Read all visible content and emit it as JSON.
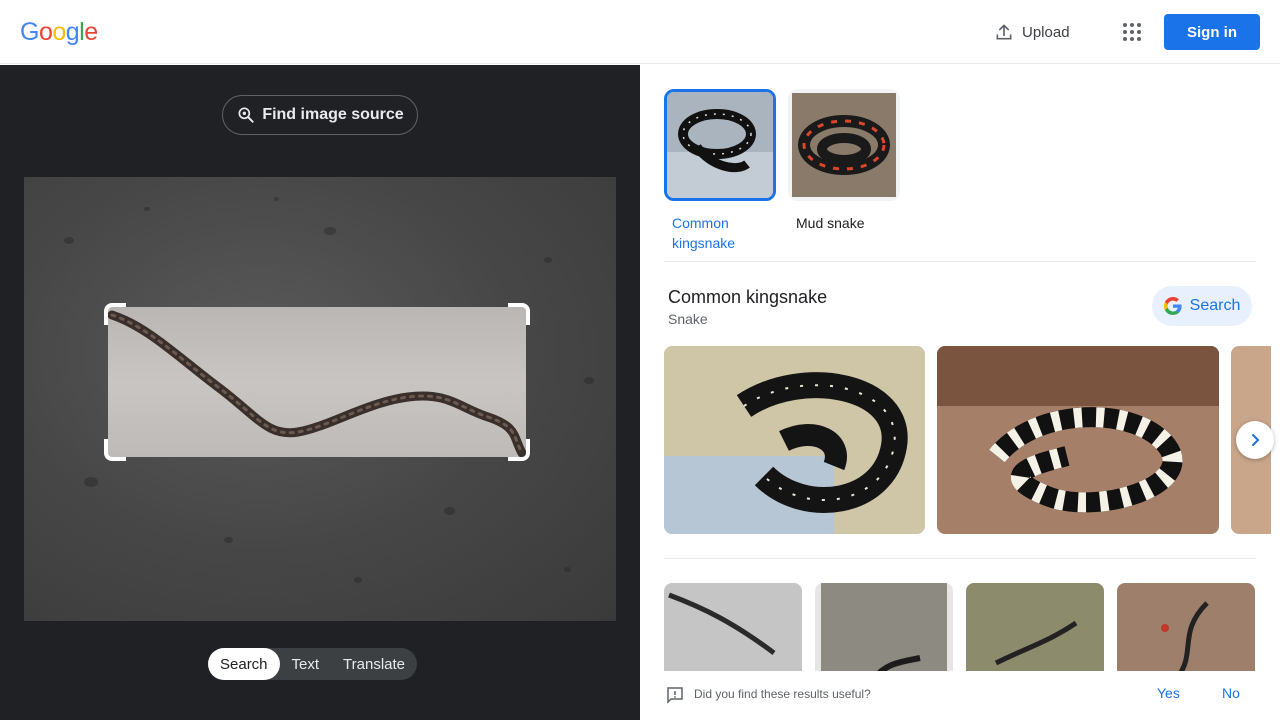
{
  "header": {
    "logo_letters": [
      {
        "char": "G",
        "color": "#4285f4"
      },
      {
        "char": "o",
        "color": "#ea4335"
      },
      {
        "char": "o",
        "color": "#fbbc05"
      },
      {
        "char": "g",
        "color": "#4285f4"
      },
      {
        "char": "l",
        "color": "#34a853"
      },
      {
        "char": "e",
        "color": "#ea4335"
      }
    ],
    "upload_label": "Upload",
    "upload_icon": "upload-icon",
    "apps_icon": "apps-grid-icon",
    "signin_label": "Sign in"
  },
  "left": {
    "find_source_label": "Find image source",
    "find_source_icon": "lens-search-icon",
    "tabs": [
      {
        "label": "Search",
        "active": true
      },
      {
        "label": "Text",
        "active": false
      },
      {
        "label": "Translate",
        "active": false
      }
    ]
  },
  "right": {
    "chips": [
      {
        "label": "Common kingsnake",
        "active": true
      },
      {
        "label": "Mud snake",
        "active": false
      }
    ],
    "entity": {
      "title": "Common kingsnake",
      "subtitle": "Snake",
      "search_label": "Search"
    },
    "feedback": {
      "question": "Did you find these results useful?",
      "yes": "Yes",
      "no": "No"
    }
  },
  "colors": {
    "accent": "#1a73e8",
    "dark_bg": "#202124"
  }
}
